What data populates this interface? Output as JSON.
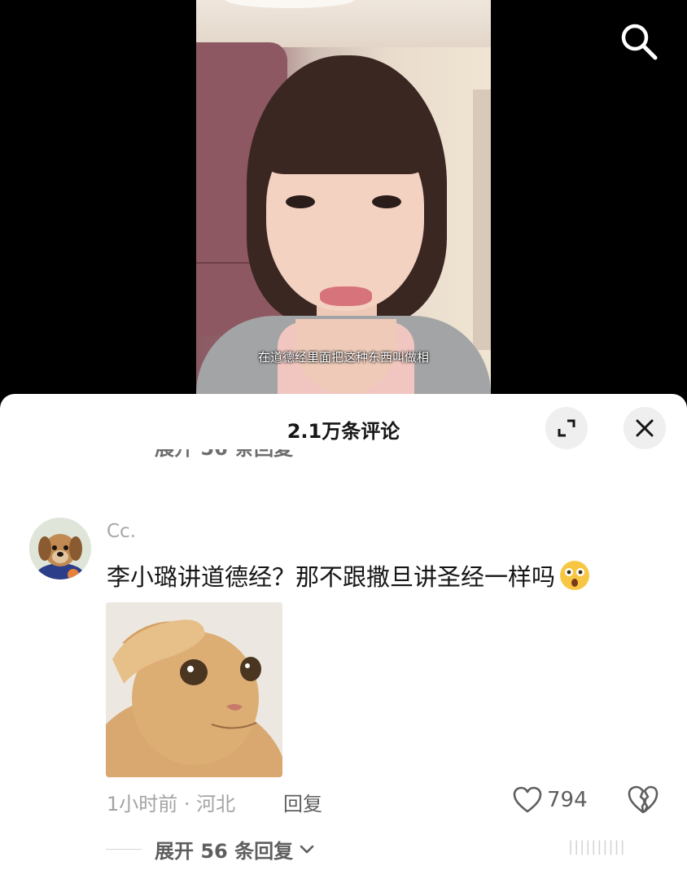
{
  "video": {
    "subtitle": "在道德经里面把这种东西叫做相"
  },
  "top_bar": {
    "search_icon": "search-icon"
  },
  "comments_panel": {
    "title": "2.1万条评论",
    "expand_icon": "expand-icon",
    "close_icon": "close-icon",
    "partial_reply_text": "展开 56 条回复"
  },
  "comment": {
    "username": "Cc.",
    "text": "李小璐讲道德经？那不跟撒旦讲圣经一样吗",
    "emoji": "astonished-face-emoji",
    "image_description_icon": "cat-meme-image",
    "time_location": "1小时前 · 河北",
    "reply_label": "回复",
    "like_count": "794",
    "expand_replies": "展开 56 条回复"
  },
  "watermark": "||||||||||"
}
